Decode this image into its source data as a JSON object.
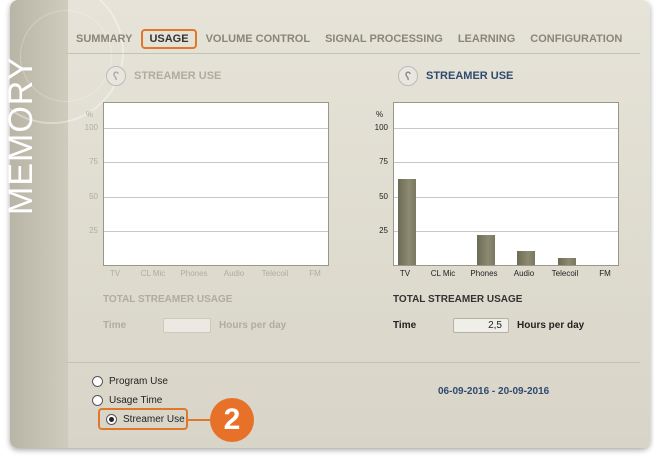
{
  "sidebar": {
    "title": "MEMORY"
  },
  "tabs": [
    {
      "label": "SUMMARY",
      "active": false
    },
    {
      "label": "USAGE",
      "active": true
    },
    {
      "label": "VOLUME CONTROL",
      "active": false
    },
    {
      "label": "SIGNAL PROCESSING",
      "active": false
    },
    {
      "label": "LEARNING",
      "active": false
    },
    {
      "label": "CONFIGURATION",
      "active": false
    }
  ],
  "left": {
    "title": "STREAMER USE",
    "y_unit": "%",
    "y_ticks": [
      "100",
      "75",
      "50",
      "25"
    ],
    "categories": [
      "TV",
      "CL Mic",
      "Phones",
      "Audio",
      "Telecoil",
      "FM"
    ],
    "stat_title": "TOTAL STREAMER USAGE",
    "time_label": "Time",
    "time_value": "",
    "time_unit": "Hours per day",
    "enabled": false
  },
  "right": {
    "title": "STREAMER USE",
    "y_unit": "%",
    "y_ticks": [
      "100",
      "75",
      "50",
      "25"
    ],
    "categories": [
      "TV",
      "CL Mic",
      "Phones",
      "Audio",
      "Telecoil",
      "FM"
    ],
    "stat_title": "TOTAL STREAMER USAGE",
    "time_label": "Time",
    "time_value": "2,5",
    "time_unit": "Hours per day",
    "enabled": true
  },
  "chart_data": {
    "type": "bar",
    "title": "STREAMER USE",
    "categories": [
      "TV",
      "CL Mic",
      "Phones",
      "Audio",
      "Telecoil",
      "FM"
    ],
    "values": [
      63,
      0,
      22,
      10,
      5,
      0
    ],
    "ylabel": "%",
    "ylim": [
      0,
      100
    ],
    "grid": true
  },
  "radio": {
    "options": [
      "Program Use",
      "Usage Time",
      "Streamer Use"
    ],
    "selected_index": 2
  },
  "callout": {
    "number": "2"
  },
  "date_range": "06-09-2016 - 20-09-2016",
  "colors": {
    "accent": "#e0772a",
    "bar": "#7a7862",
    "date_text": "#2f4a6e"
  }
}
